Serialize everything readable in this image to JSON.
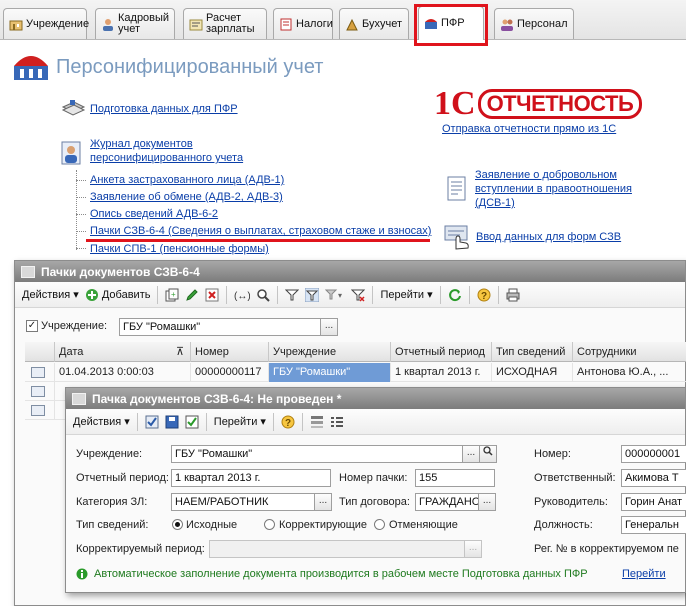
{
  "tabs": [
    {
      "label": "Учреждение",
      "icon": "institution-icon",
      "active": false
    },
    {
      "label": "Кадровый учет",
      "icon": "personnel-records-icon",
      "active": false
    },
    {
      "label": "Расчет зарплаты",
      "icon": "payroll-icon",
      "active": false
    },
    {
      "label": "Налоги",
      "icon": "taxes-icon",
      "active": false
    },
    {
      "label": "Бухучет",
      "icon": "accounting-icon",
      "active": false
    },
    {
      "label": "ПФР",
      "icon": "pfr-icon",
      "active": true
    },
    {
      "label": "Персонал",
      "icon": "staff-icon",
      "active": false
    }
  ],
  "panel": {
    "title": "Персонифицированный учет",
    "links": {
      "prep": "Подготовка данных для ПФР",
      "journal_1": "Журнал документов",
      "journal_2": "персонифицированного учета",
      "adv1": "Анкета застрахованного лица (АДВ-1)",
      "adv2": "Заявление об обмене (АДВ-2, АДВ-3)",
      "adv62": "Опись сведений АДВ-6-2",
      "szv64": "Пачки СЗВ-6-4 (Сведения о выплатах, страховом стаже и взносах)",
      "spv1": "Пачки СПВ-1 (пенсионные формы)",
      "dsv1_1": "Заявление о добровольном",
      "dsv1_2": "вступлении в правоотношения",
      "dsv1_3": "(ДСВ-1)",
      "szv_input": "Ввод данных для форм СЗВ",
      "reporting": "Отправка отчетности  прямо из 1С"
    },
    "logo": {
      "one": "1С",
      "text": "ОТЧЕТНОСТЬ"
    }
  },
  "list_window": {
    "title": "Пачки документов СЗВ-6-4",
    "toolbar": {
      "actions": "Действия",
      "add": "Добавить",
      "goto": "Перейти"
    },
    "filter": {
      "label": "Учреждение:",
      "value": "ГБУ \"Ромашки\"",
      "checked": true
    },
    "columns": [
      "Дата",
      "Номер",
      "Учреждение",
      "Отчетный период",
      "Тип сведений",
      "Сотрудники"
    ],
    "rows": [
      [
        "01.04.2013 0:00:03",
        "00000000117",
        "ГБУ \"Ромашки\"",
        "1 квартал 2013 г.",
        "ИСХОДНАЯ",
        "Антонова Ю.А., ..."
      ],
      [
        "",
        "",
        "",
        "",
        "",
        ""
      ],
      [
        "",
        "",
        "",
        "",
        "",
        ""
      ]
    ]
  },
  "doc_window": {
    "title": "Пачка документов СЗВ-6-4: Не проведен *",
    "toolbar": {
      "actions": "Действия",
      "goto": "Перейти"
    },
    "fields": {
      "institution_label": "Учреждение:",
      "institution_value": "ГБУ \"Ромашки\"",
      "number_label": "Номер:",
      "number_value": "000000001",
      "period_label": "Отчетный период:",
      "period_value": "1 квартал 2013 г.",
      "pack_label": "Номер пачки:",
      "pack_value": "155",
      "responsible_label": "Ответственный:",
      "responsible_value": "Акимова Т",
      "category_label": "Категория ЗЛ:",
      "category_value": "НАЕМ/РАБОТНИК",
      "contract_label": "Тип договора:",
      "contract_value": "ГРАЖДАНС",
      "head_label": "Руководитель:",
      "head_value": "Горин Анат",
      "info_type_label": "Тип сведений:",
      "radio_initial": "Исходные",
      "radio_corrective": "Корректирующие",
      "radio_cancel": "Отменяющие",
      "position_label": "Должность:",
      "position_value": "Генеральн",
      "corrected_label": "Корректируемый период:",
      "reg_label": "Рег. № в корректируемом пе"
    },
    "info": {
      "text": "Автоматическое заполнение документа производится в рабочем месте Подготовка данных ПФР",
      "link": "Перейти"
    }
  },
  "colors": {
    "accent_red": "#e0141c",
    "link_blue": "#0a3ea8",
    "title_blue": "#7b9bbf",
    "selection": "#6f9bd6"
  }
}
